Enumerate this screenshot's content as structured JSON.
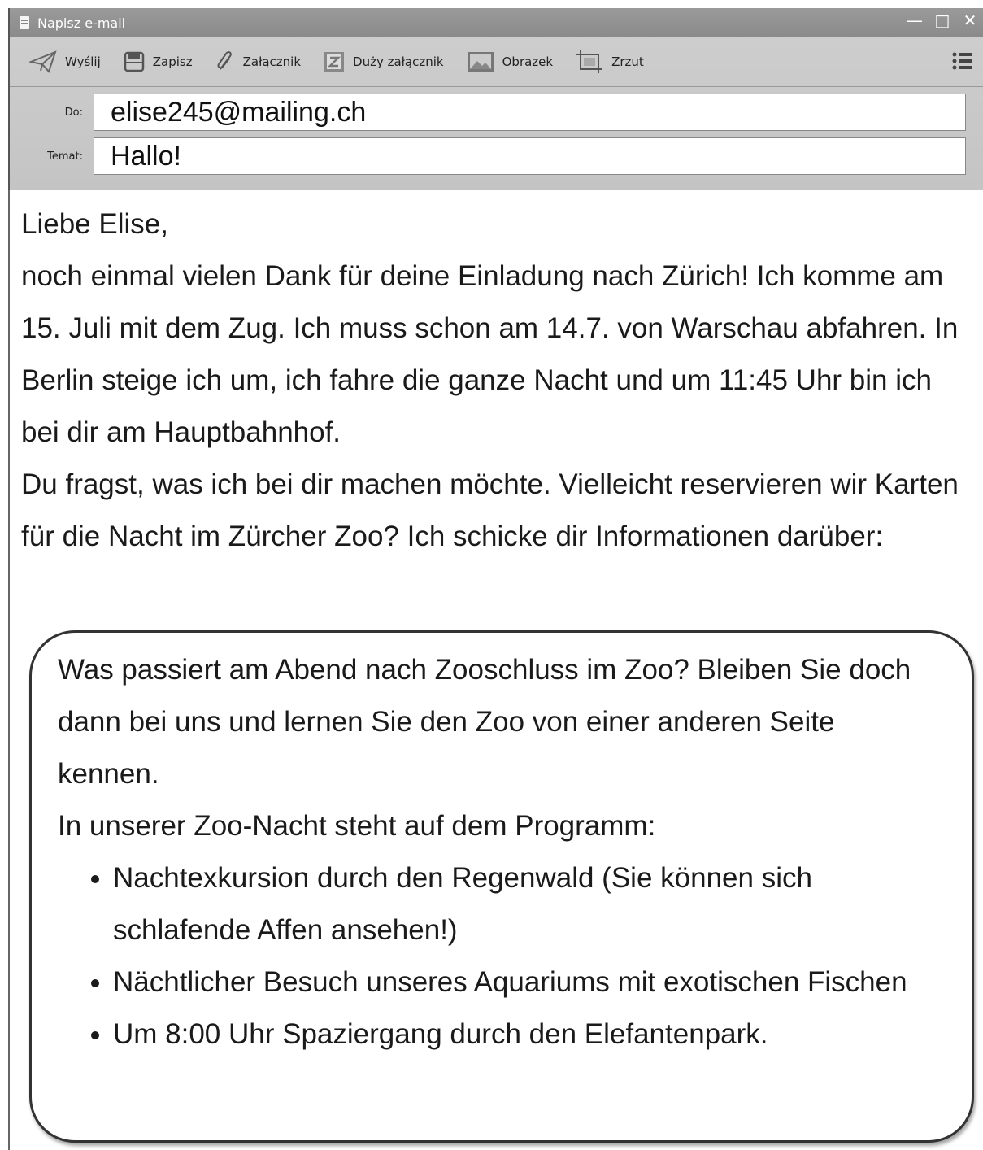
{
  "window": {
    "title": "Napisz e-mail",
    "controls": {
      "minimize": "—",
      "maximize": "□",
      "close": "✕"
    }
  },
  "toolbar": {
    "buttons": [
      {
        "label": "Wyślij",
        "icon": "send-icon"
      },
      {
        "label": "Zapisz",
        "icon": "save-icon"
      },
      {
        "label": "Załącznik",
        "icon": "paperclip-icon"
      },
      {
        "label": "Duży załącznik",
        "icon": "large-attachment-icon"
      },
      {
        "label": "Obrazek",
        "icon": "image-icon"
      },
      {
        "label": "Zrzut",
        "icon": "screenshot-icon"
      }
    ],
    "menu_icon": "menu-list-icon"
  },
  "fields": {
    "to_label": "Do:",
    "to_value": "elise245@mailing.ch",
    "subject_label": "Temat:",
    "subject_value": "Hallo!"
  },
  "message": {
    "greeting": "Liebe Elise,",
    "paragraph1": "noch einmal vielen Dank für deine Einladung nach Zürich! Ich komme am 15. Juli mit dem Zug. Ich muss schon am 14.7. von Warschau abfahren. In Berlin steige ich um, ich fahre die ganze Nacht und um 11:45 Uhr bin ich bei dir am Hauptbahnhof.",
    "paragraph2": "Du fragst, was ich bei dir machen möchte. Vielleicht reservieren wir Karten für die Nacht im Zürcher Zoo? Ich schicke dir Informationen darüber:"
  },
  "info_box": {
    "intro": "Was passiert am Abend nach Zooschluss im Zoo? Bleiben Sie doch dann bei uns und lernen Sie den Zoo von einer anderen Seite kennen.",
    "program_heading": "In unserer Zoo-Nacht steht auf dem Programm:",
    "items": [
      "Nachtexkursion durch den Regenwald (Sie können sich schlafende Affen ansehen!)",
      "Nächtlicher Besuch unseres Aquariums mit exotischen Fischen",
      "Um 8:00 Uhr Spaziergang durch den Elefantenpark."
    ]
  }
}
